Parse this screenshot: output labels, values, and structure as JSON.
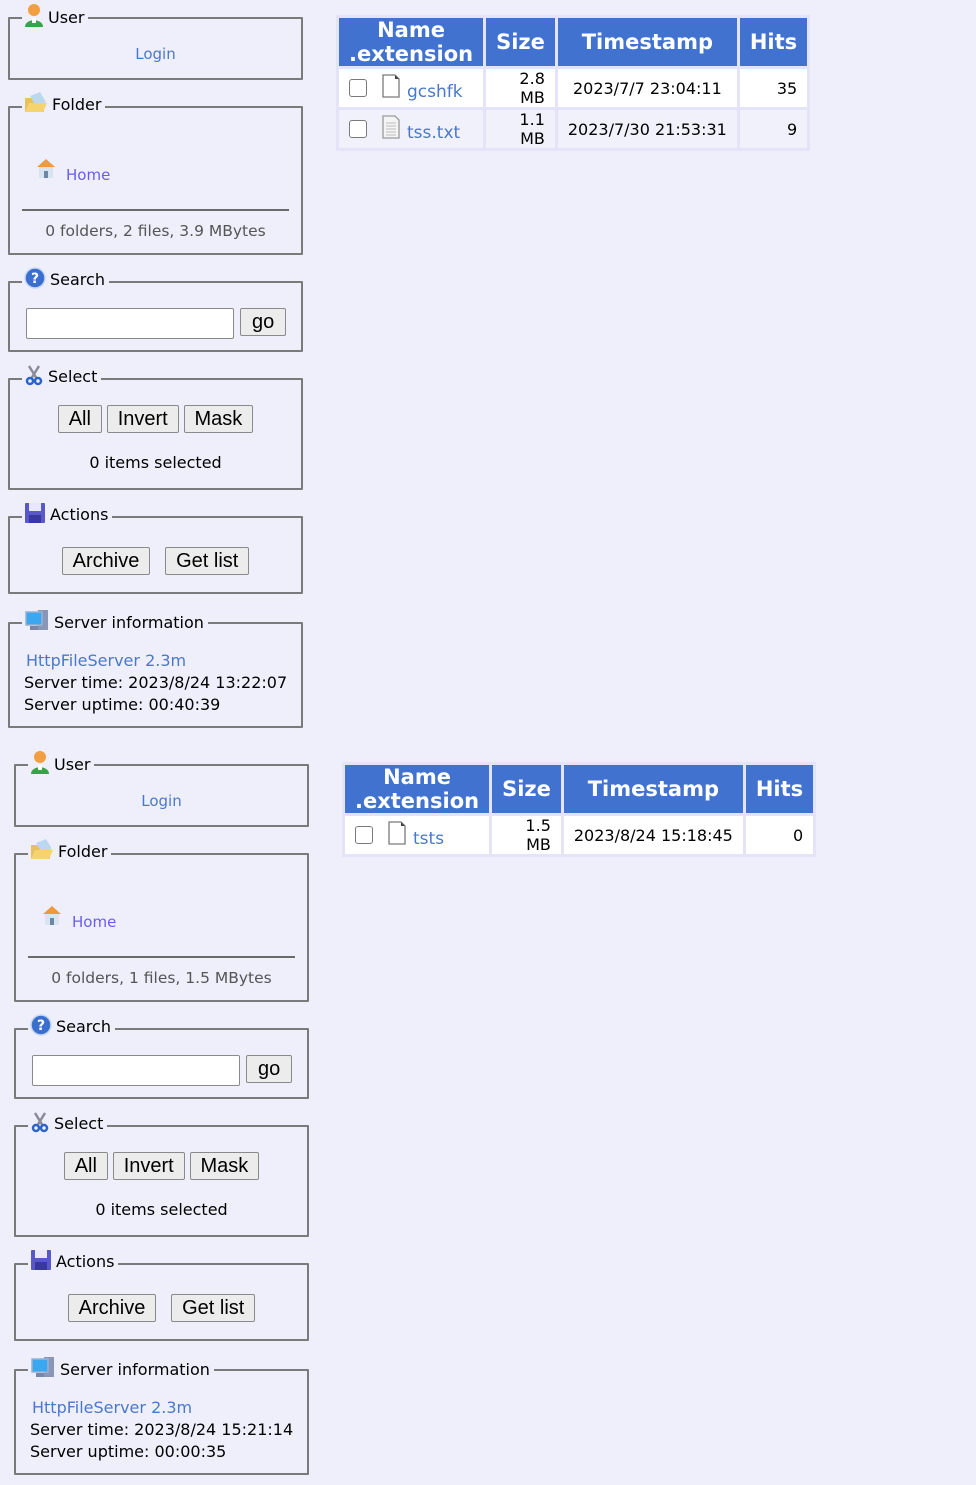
{
  "panels": [
    {
      "user": {
        "title": "User",
        "login_label": "Login"
      },
      "folder": {
        "title": "Folder",
        "home_label": "Home",
        "stats": "0 folders, 2 files, 3.9 MBytes"
      },
      "search": {
        "title": "Search",
        "input_value": "",
        "go_label": "go"
      },
      "select": {
        "title": "Select",
        "all_label": "All",
        "invert_label": "Invert",
        "mask_label": "Mask",
        "status": "0 items selected"
      },
      "actions": {
        "title": "Actions",
        "archive_label": "Archive",
        "getlist_label": "Get list"
      },
      "server": {
        "title": "Server information",
        "version_link": "HttpFileServer 2.3m",
        "time": "Server time: 2023/8/24 13:22:07",
        "uptime": "Server uptime: 00:40:39"
      },
      "table": {
        "headers": [
          "Name .extension",
          "Size",
          "Timestamp",
          "Hits"
        ],
        "rows": [
          {
            "name": "gcshfk",
            "icon": "blank-file-icon",
            "size": "2.8 MB",
            "timestamp": "2023/7/7 23:04:11",
            "hits": "35"
          },
          {
            "name": "tss.txt",
            "icon": "text-file-icon",
            "size": "1.1 MB",
            "timestamp": "2023/7/30 21:53:31",
            "hits": "9"
          }
        ]
      }
    },
    {
      "user": {
        "title": "User",
        "login_label": "Login"
      },
      "folder": {
        "title": "Folder",
        "home_label": "Home",
        "stats": "0 folders, 1 files, 1.5 MBytes"
      },
      "search": {
        "title": "Search",
        "input_value": "",
        "go_label": "go"
      },
      "select": {
        "title": "Select",
        "all_label": "All",
        "invert_label": "Invert",
        "mask_label": "Mask",
        "status": "0 items selected"
      },
      "actions": {
        "title": "Actions",
        "archive_label": "Archive",
        "getlist_label": "Get list"
      },
      "server": {
        "title": "Server information",
        "version_link": "HttpFileServer 2.3m",
        "time": "Server time: 2023/8/24 15:21:14",
        "uptime": "Server uptime: 00:00:35"
      },
      "table": {
        "headers": [
          "Name .extension",
          "Size",
          "Timestamp",
          "Hits"
        ],
        "rows": [
          {
            "name": "tsts",
            "icon": "blank-file-icon",
            "size": "1.5 MB",
            "timestamp": "2023/8/24 15:18:45",
            "hits": "0"
          }
        ]
      }
    }
  ]
}
